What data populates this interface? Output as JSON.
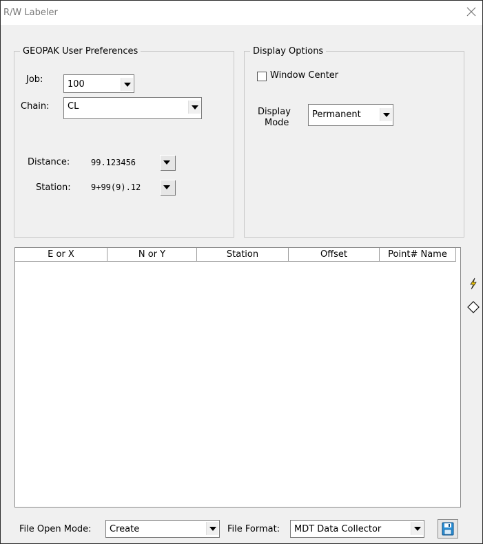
{
  "window": {
    "title": "R/W Labeler"
  },
  "preferences": {
    "legend": "GEOPAK User Preferences",
    "job_label": "Job:",
    "job_value": "100",
    "chain_label": "Chain:",
    "chain_value": "CL",
    "distance_label": "Distance:",
    "distance_value": "99.123456",
    "station_label": "Station:",
    "station_value": "9+99(9).12"
  },
  "display": {
    "legend": "Display Options",
    "window_center_label": "Window Center",
    "window_center_checked": false,
    "mode_label_line1": "Display",
    "mode_label_line2": "Mode",
    "mode_value": "Permanent"
  },
  "table": {
    "columns": [
      "E or X",
      "N or Y",
      "Station",
      "Offset",
      "Point# Name"
    ],
    "rows": []
  },
  "side_tools": [
    "lightning-icon",
    "diamond-icon"
  ],
  "footer": {
    "file_open_mode_label": "File Open Mode:",
    "file_open_mode_value": "Create",
    "file_format_label": "File Format:",
    "file_format_value": "MDT Data Collector",
    "save_icon": "save-icon"
  },
  "colors": {
    "window_bg": "#f0f0f0",
    "save_icon": "#2a8fd6"
  }
}
